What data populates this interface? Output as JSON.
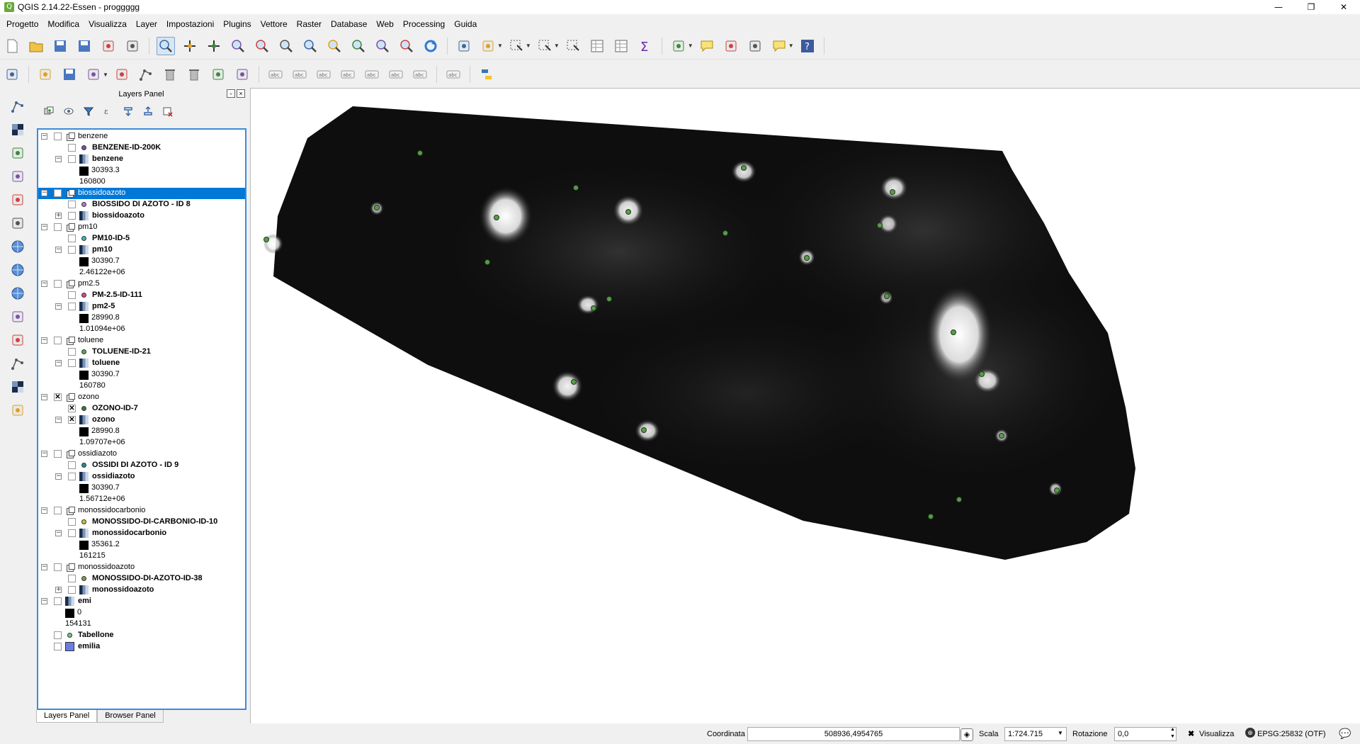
{
  "window": {
    "title": "QGIS 2.14.22-Essen - proggggg",
    "buttons": [
      "—",
      "❐",
      "✕"
    ]
  },
  "menu": [
    "Progetto",
    "Modifica",
    "Visualizza",
    "Layer",
    "Impostazioni",
    "Plugins",
    "Vettore",
    "Raster",
    "Database",
    "Web",
    "Processing",
    "Guida"
  ],
  "layers_panel": {
    "title": "Layers Panel",
    "tabs": [
      "Layers Panel",
      "Browser Panel"
    ],
    "rows": [
      {
        "label": "benzene",
        "kind": "group",
        "bold": false,
        "level": 0,
        "checked": false,
        "expand": "minus"
      },
      {
        "label": "BENZENE-ID-200K",
        "kind": "point",
        "bold": true,
        "level": 1,
        "checked": false,
        "color": "#7a52a6"
      },
      {
        "label": "benzene",
        "kind": "raster",
        "bold": true,
        "level": 1,
        "checked": false,
        "expand": "minus"
      },
      {
        "label": "30393.3",
        "kind": "legend-black",
        "bold": false,
        "level": 2
      },
      {
        "label": "160800",
        "kind": "legend",
        "bold": false,
        "level": 2
      },
      {
        "label": "biossidoazoto",
        "kind": "group",
        "bold": false,
        "level": 0,
        "checked": false,
        "expand": "minus",
        "selected": true
      },
      {
        "label": "BIOSSIDO DI AZOTO - ID 8",
        "kind": "point",
        "bold": true,
        "level": 1,
        "checked": false,
        "color": "#c46fd6"
      },
      {
        "label": "biossidoazoto",
        "kind": "raster",
        "bold": true,
        "level": 1,
        "checked": false,
        "expand": "plus"
      },
      {
        "label": "pm10",
        "kind": "group",
        "bold": false,
        "level": 0,
        "checked": false,
        "expand": "minus"
      },
      {
        "label": "PM10-ID-5",
        "kind": "point",
        "bold": true,
        "level": 1,
        "checked": false,
        "color": "#3fbab5"
      },
      {
        "label": "pm10",
        "kind": "raster",
        "bold": true,
        "level": 1,
        "checked": false,
        "expand": "minus"
      },
      {
        "label": "30390.7",
        "kind": "legend-black",
        "bold": false,
        "level": 2
      },
      {
        "label": "2.46122e+06",
        "kind": "legend",
        "bold": false,
        "level": 2
      },
      {
        "label": "pm2.5",
        "kind": "group",
        "bold": false,
        "level": 0,
        "checked": false,
        "expand": "minus"
      },
      {
        "label": "PM-2.5-ID-111",
        "kind": "point",
        "bold": true,
        "level": 1,
        "checked": false,
        "color": "#d6478a"
      },
      {
        "label": "pm2-5",
        "kind": "raster",
        "bold": true,
        "level": 1,
        "checked": false,
        "expand": "minus"
      },
      {
        "label": "28990.8",
        "kind": "legend-black",
        "bold": false,
        "level": 2
      },
      {
        "label": "1.01094e+06",
        "kind": "legend",
        "bold": false,
        "level": 2
      },
      {
        "label": "toluene",
        "kind": "group",
        "bold": false,
        "level": 0,
        "checked": false,
        "expand": "minus"
      },
      {
        "label": "TOLUENE-ID-21",
        "kind": "point",
        "bold": true,
        "level": 1,
        "checked": false,
        "color": "#5aa85a"
      },
      {
        "label": "toluene",
        "kind": "raster",
        "bold": true,
        "level": 1,
        "checked": false,
        "expand": "minus"
      },
      {
        "label": "30390.7",
        "kind": "legend-black",
        "bold": false,
        "level": 2
      },
      {
        "label": "160780",
        "kind": "legend",
        "bold": false,
        "level": 2
      },
      {
        "label": "ozono",
        "kind": "group",
        "bold": false,
        "level": 0,
        "checked": true,
        "expand": "minus"
      },
      {
        "label": "OZONO-ID-7",
        "kind": "point",
        "bold": true,
        "level": 1,
        "checked": true,
        "color": "#2e7f3a"
      },
      {
        "label": "ozono",
        "kind": "raster",
        "bold": true,
        "level": 1,
        "checked": true,
        "expand": "minus"
      },
      {
        "label": "28990.8",
        "kind": "legend-black",
        "bold": false,
        "level": 2
      },
      {
        "label": "1.09707e+06",
        "kind": "legend",
        "bold": false,
        "level": 2
      },
      {
        "label": "ossidiazoto",
        "kind": "group",
        "bold": false,
        "level": 0,
        "checked": false,
        "expand": "minus"
      },
      {
        "label": "OSSIDI DI AZOTO - ID 9",
        "kind": "point",
        "bold": true,
        "level": 1,
        "checked": false,
        "color": "#2b8a8a"
      },
      {
        "label": "ossidiazoto",
        "kind": "raster",
        "bold": true,
        "level": 1,
        "checked": false,
        "expand": "minus"
      },
      {
        "label": "30390.7",
        "kind": "legend-black",
        "bold": false,
        "level": 2
      },
      {
        "label": "1.56712e+06",
        "kind": "legend",
        "bold": false,
        "level": 2
      },
      {
        "label": "monossidocarbonio",
        "kind": "group",
        "bold": false,
        "level": 0,
        "checked": false,
        "expand": "minus"
      },
      {
        "label": "MONOSSIDO-DI-CARBONIO-ID-10",
        "kind": "point",
        "bold": true,
        "level": 1,
        "checked": false,
        "color": "#c9c23a"
      },
      {
        "label": "monossidocarbonio",
        "kind": "raster",
        "bold": true,
        "level": 1,
        "checked": false,
        "expand": "minus"
      },
      {
        "label": "35361.2",
        "kind": "legend-black",
        "bold": false,
        "level": 2
      },
      {
        "label": "161215",
        "kind": "legend",
        "bold": false,
        "level": 2
      },
      {
        "label": "monossidoazoto",
        "kind": "group",
        "bold": false,
        "level": 0,
        "checked": false,
        "expand": "minus"
      },
      {
        "label": "MONOSSIDO-DI-AZOTO-ID-38",
        "kind": "point",
        "bold": true,
        "level": 1,
        "checked": false,
        "color": "#7aa13f"
      },
      {
        "label": "monossidoazoto",
        "kind": "raster",
        "bold": true,
        "level": 1,
        "checked": false,
        "expand": "plus"
      },
      {
        "label": "emi",
        "kind": "raster",
        "bold": true,
        "level": 0,
        "checked": false,
        "expand": "minus"
      },
      {
        "label": "0",
        "kind": "legend-black",
        "bold": false,
        "level": 1
      },
      {
        "label": "154131",
        "kind": "legend",
        "bold": false,
        "level": 1
      },
      {
        "label": "Tabellone",
        "kind": "point",
        "bold": true,
        "level": 0,
        "checked": false,
        "color": "#7bc47b"
      },
      {
        "label": "emilia",
        "kind": "polygon",
        "bold": true,
        "level": 0,
        "checked": false,
        "color": "#6a7de0"
      }
    ]
  },
  "statusbar": {
    "coord_label": "Coordinata",
    "coord_value": "508936,4954765",
    "scale_label": "Scala",
    "scale_value": "1:724.715",
    "rotation_label": "Rotazione",
    "rotation_value": "0,0",
    "render_label": "Visualizza",
    "crs_label": "EPSG:25832 (OTF)"
  },
  "icons": {
    "toolbar1": [
      "new-project-icon",
      "open-project-icon",
      "save-project-icon",
      "save-as-icon",
      "new-print-composer-icon",
      "composer-manager-icon",
      "touch-zoom-icon",
      "pan-icon",
      "pan-to-selection-icon",
      "zoom-in-icon",
      "zoom-out-icon",
      "zoom-actual-icon",
      "zoom-full-icon",
      "zoom-selection-icon",
      "zoom-layer-icon",
      "zoom-last-icon",
      "zoom-next-icon",
      "refresh-icon",
      "identify-icon",
      "action-icon",
      "select-icon",
      "select-by-expression-icon",
      "deselect-icon",
      "attribute-table-icon",
      "statistics-icon",
      "field-calculator-icon",
      "measure-icon",
      "map-tips-icon",
      "new-bookmark-icon",
      "show-bookmarks-icon",
      "text-annotation-icon",
      "help-icon"
    ],
    "toolbar2": [
      "current-edits-icon",
      "toggle-editing-icon",
      "save-edits-icon",
      "add-feature-icon",
      "move-feature-icon",
      "node-tool-icon",
      "delete-selected-icon",
      "cut-features-icon",
      "copy-features-icon",
      "paste-features-icon",
      "label-tool-icon",
      "highlight-label-icon",
      "pin-label-icon",
      "show-label-icon",
      "move-label-icon",
      "rotate-label-icon",
      "change-label-icon",
      "csw-icon",
      "python-console-icon"
    ],
    "left": [
      "add-vector-layer-icon",
      "add-raster-layer-icon",
      "add-postgis-icon",
      "add-spatialite-icon",
      "add-mssql-icon",
      "add-oracle-icon",
      "add-wms-icon",
      "add-wcs-icon",
      "add-wfs-icon",
      "add-delimited-text-icon",
      "add-virtual-layer-icon",
      "new-shapefile-icon",
      "add-wms-grid-icon",
      "georeferencer-icon"
    ]
  }
}
